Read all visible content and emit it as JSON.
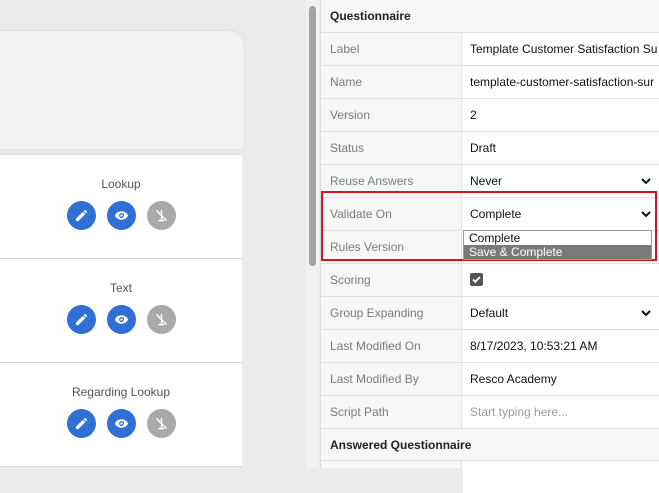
{
  "canvas": {
    "cards": [
      {
        "title": "Lookup"
      },
      {
        "title": "Text"
      },
      {
        "title": "Regarding Lookup"
      }
    ]
  },
  "panel": {
    "section_questionnaire": "Questionnaire",
    "section_answered": "Answered Questionnaire",
    "rows": {
      "label": {
        "label": "Label",
        "value": "Template Customer Satisfaction Su"
      },
      "name": {
        "label": "Name",
        "value": "template-customer-satisfaction-sur"
      },
      "version": {
        "label": "Version",
        "value": "2"
      },
      "status": {
        "label": "Status",
        "value": "Draft"
      },
      "reuse_answers": {
        "label": "Reuse Answers",
        "value": "Never"
      },
      "validate_on": {
        "label": "Validate On",
        "value": "Complete"
      },
      "rules_version": {
        "label": "Rules Version",
        "value": ""
      },
      "scoring": {
        "label": "Scoring",
        "checked": true
      },
      "group_expanding": {
        "label": "Group Expanding",
        "value": "Default"
      },
      "last_modified_on": {
        "label": "Last Modified On",
        "value": "8/17/2023, 10:53:21 AM"
      },
      "last_modified_by": {
        "label": "Last Modified By",
        "value": "Resco Academy"
      },
      "script_path": {
        "label": "Script Path",
        "placeholder": "Start typing here..."
      }
    },
    "validate_on_dropdown": {
      "options": [
        "Complete",
        "Save & Complete"
      ],
      "highlighted": "Save & Complete"
    }
  },
  "colors": {
    "action_blue": "#2f6fd6",
    "disabled_gray": "#a9a9a9",
    "highlight_red": "#d9131c"
  },
  "icons": [
    "edit-icon",
    "eye-icon",
    "hide-icon",
    "chevron-down-icon",
    "checkmark-icon"
  ]
}
